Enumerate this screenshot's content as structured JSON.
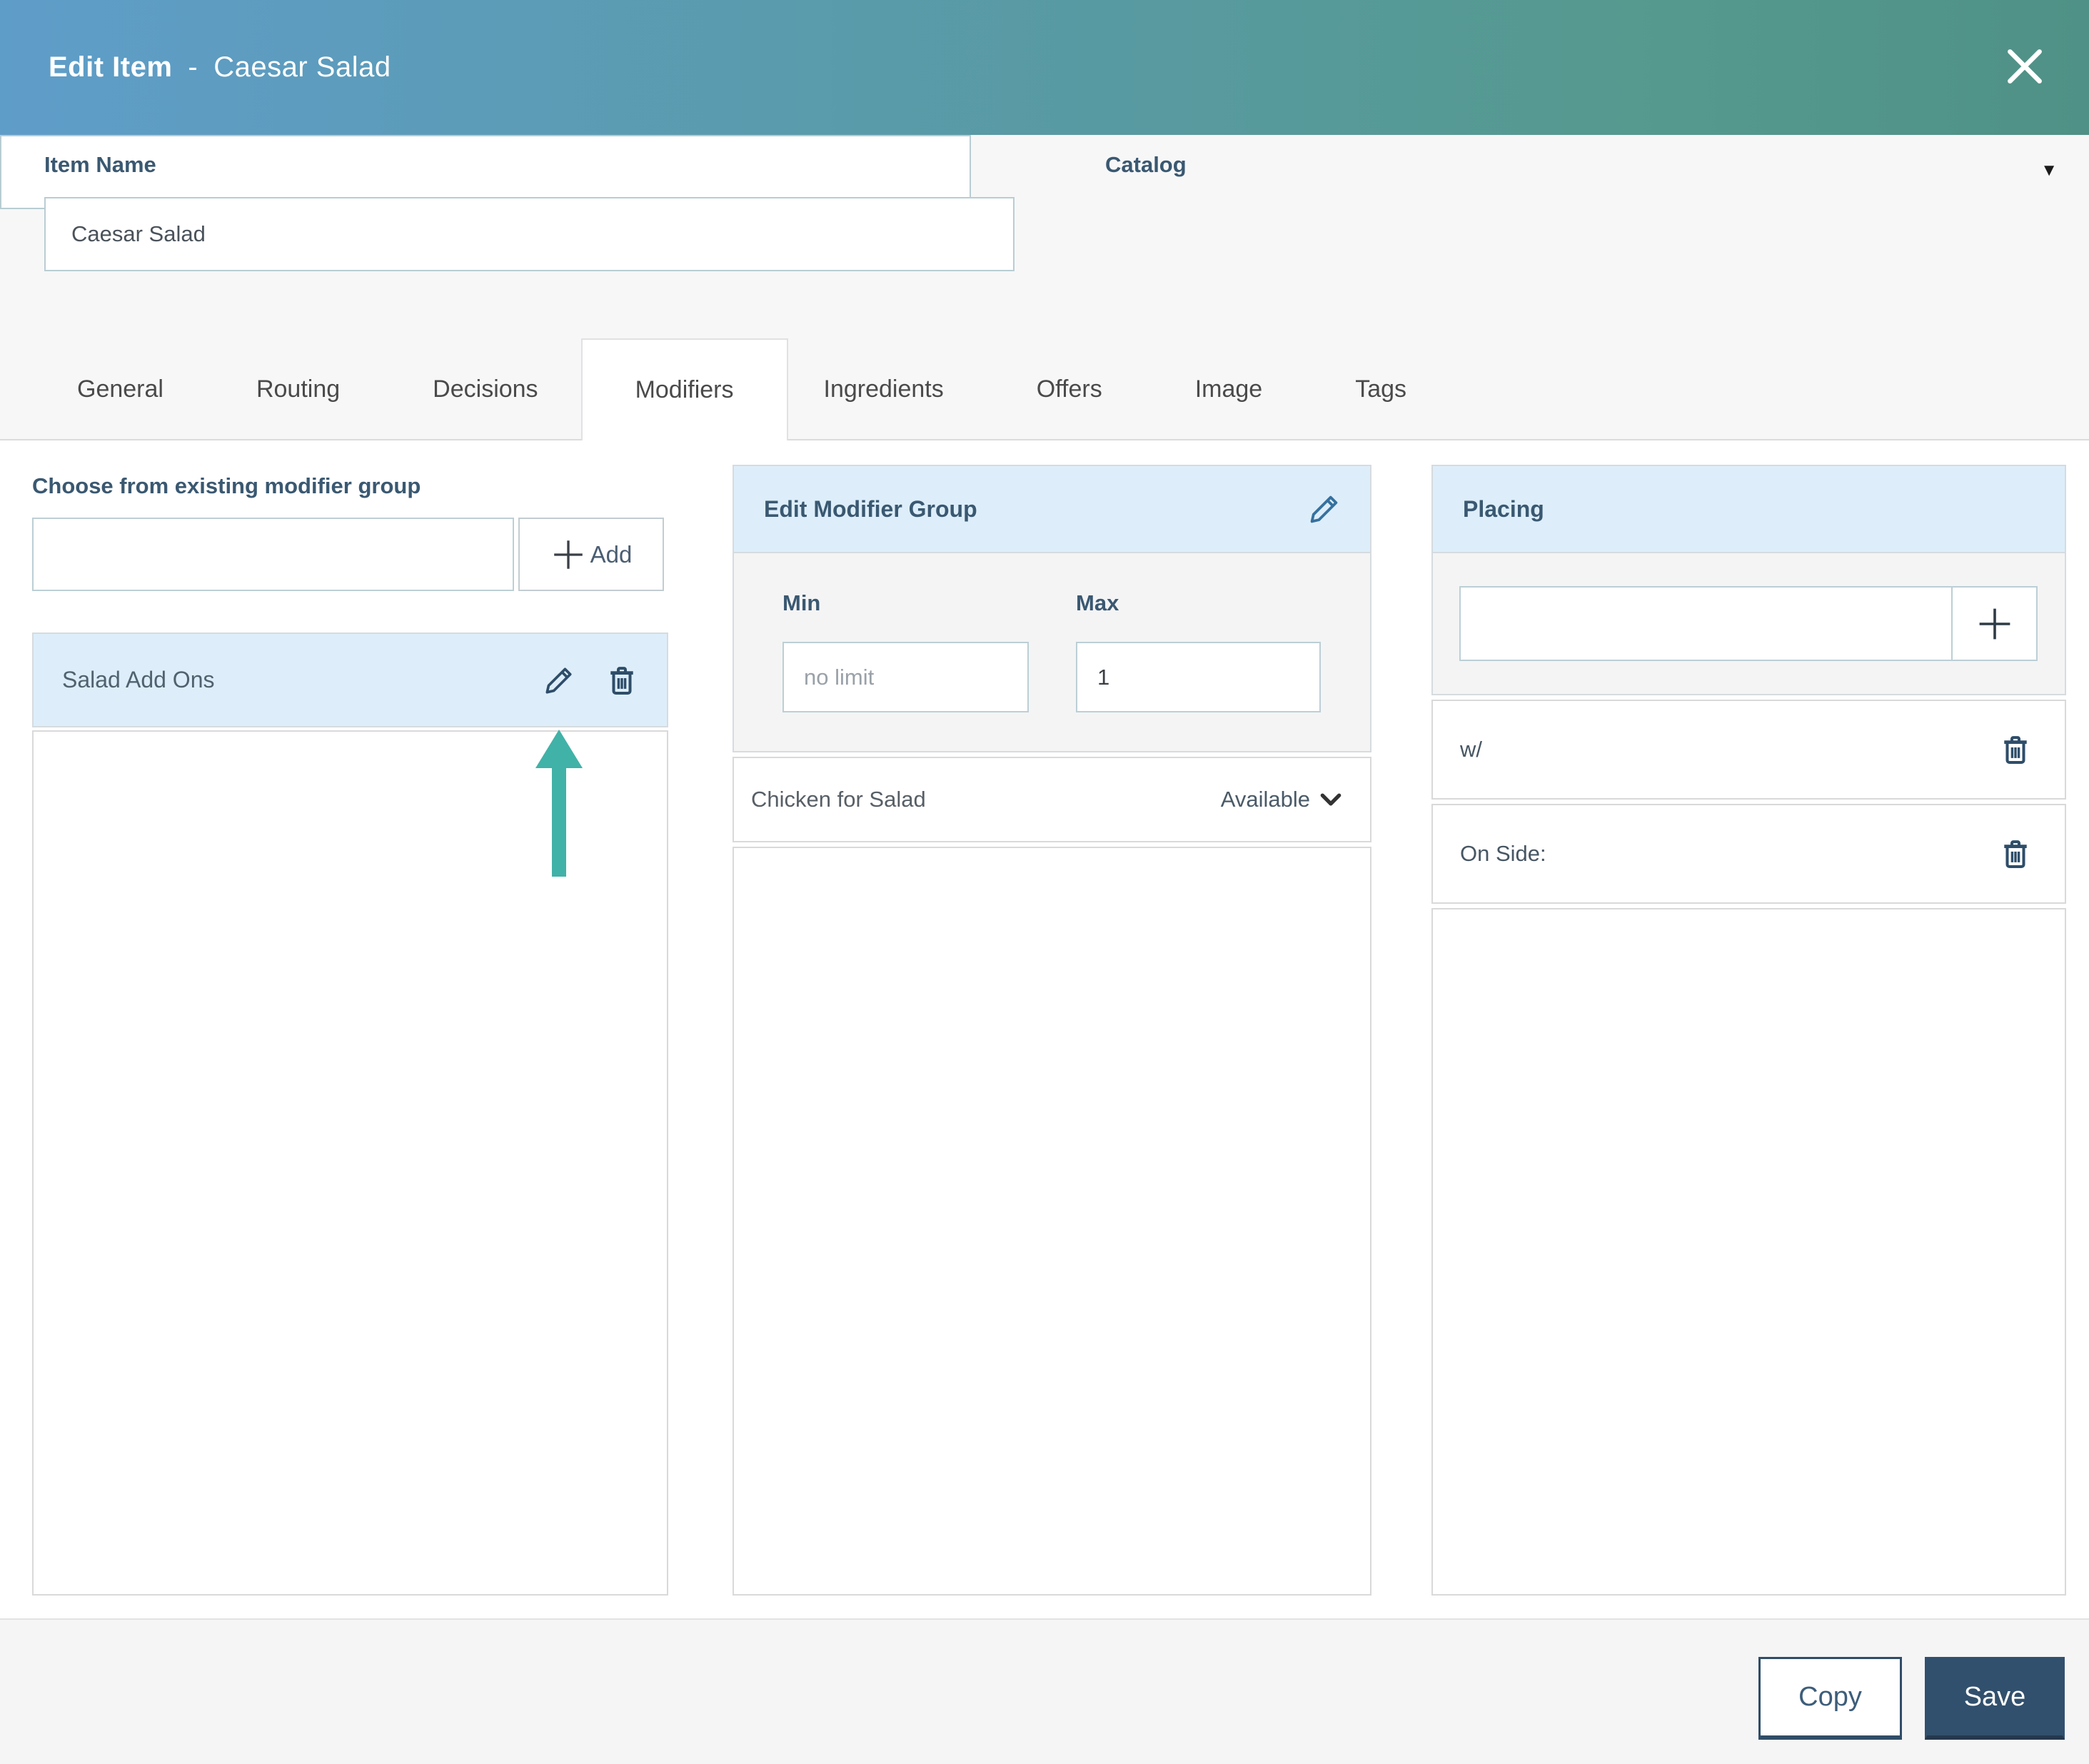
{
  "window": {
    "title_prefix": "Edit Item",
    "title_separator": "-",
    "title_item": "Caesar Salad"
  },
  "icons": {
    "close": "x-icon",
    "edit": "pencil-icon",
    "delete": "trash-icon",
    "add_plus": "plus-icon",
    "catalog_caret": "▼",
    "status_chevron": "chevron-down-icon",
    "annotation": "teal-arrow-up"
  },
  "fields": {
    "item_name": {
      "label": "Item Name",
      "value": "Caesar Salad"
    },
    "catalog": {
      "label": "Catalog",
      "value": ""
    }
  },
  "tabs": [
    {
      "label": "General",
      "active": false
    },
    {
      "label": "Routing",
      "active": false
    },
    {
      "label": "Decisions",
      "active": false
    },
    {
      "label": "Modifiers",
      "active": true
    },
    {
      "label": "Ingredients",
      "active": false
    },
    {
      "label": "Offers",
      "active": false
    },
    {
      "label": "Image",
      "active": false
    },
    {
      "label": "Tags",
      "active": false
    }
  ],
  "left_panel": {
    "choose_label": "Choose from existing modifier group",
    "search_value": "",
    "add_button_label": "Add",
    "group_name": "Salad Add Ons"
  },
  "middle_panel": {
    "title": "Edit Modifier Group",
    "min_label": "Min",
    "min_placeholder": "no limit",
    "min_value": "",
    "max_label": "Max",
    "max_value": "1",
    "modifiers": [
      {
        "name": "Chicken for Salad",
        "status": "Available"
      }
    ]
  },
  "right_panel": {
    "title": "Placing",
    "input_value": "",
    "placings": [
      {
        "name": "w/"
      },
      {
        "name": "On Side:"
      }
    ]
  },
  "footer": {
    "copy_label": "Copy",
    "save_label": "Save"
  },
  "colors": {
    "header_gradient_left": "#5f9dc9",
    "header_gradient_right": "#4f9186",
    "panel_header_bg": "#ddeefa",
    "label_blue": "#3a5871",
    "icon_navy": "#2e4d69",
    "save_button_bg": "#31506d",
    "annotation_teal": "#41b2a7"
  }
}
